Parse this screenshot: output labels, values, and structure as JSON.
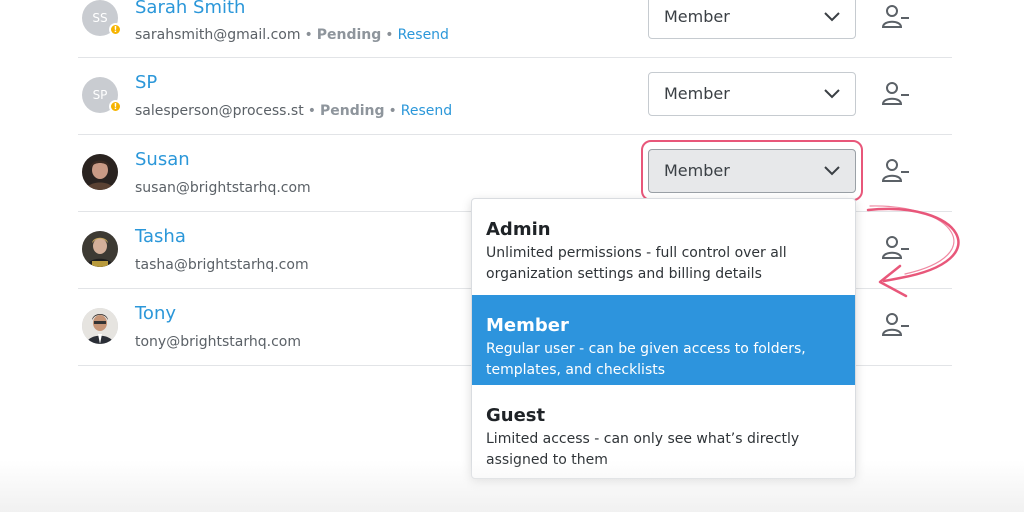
{
  "members": [
    {
      "initials": "SS",
      "name": "Sarah Smith",
      "email": "sarahsmith@gmail.com",
      "status": "Pending",
      "resend": "Resend",
      "role": "Member",
      "avatar_color": "#c9ccd1"
    },
    {
      "initials": "SP",
      "name": "SP",
      "email": "salesperson@process.st",
      "status": "Pending",
      "resend": "Resend",
      "role": "Member",
      "avatar_color": "#c9ccd1"
    },
    {
      "name": "Susan",
      "email": "susan@brightstarhq.com",
      "role": "Member"
    },
    {
      "name": "Tasha",
      "email": "tasha@brightstarhq.com"
    },
    {
      "name": "Tony",
      "email": "tony@brightstarhq.com"
    }
  ],
  "role_menu": {
    "options": [
      {
        "title": "Admin",
        "desc_line1": "Unlimited permissions - full control over all",
        "desc_line2": "organization settings and billing details"
      },
      {
        "title": "Member",
        "desc_line1": "Regular user - can be given access to folders,",
        "desc_line2": "templates, and checklists",
        "selected": true
      },
      {
        "title": "Guest",
        "desc_line1": "Limited access - can only see what’s directly",
        "desc_line2": "assigned to them"
      }
    ]
  },
  "icons": {
    "dropdown": "chevron-down-icon",
    "remove": "remove-user-icon",
    "warning": "warning-badge-icon",
    "annotation": "curved-arrow-icon"
  },
  "colors": {
    "link_blue": "#2b97d9",
    "selected_option": "#2d94dd",
    "highlight": "#e8577a",
    "warning": "#f6b400"
  }
}
